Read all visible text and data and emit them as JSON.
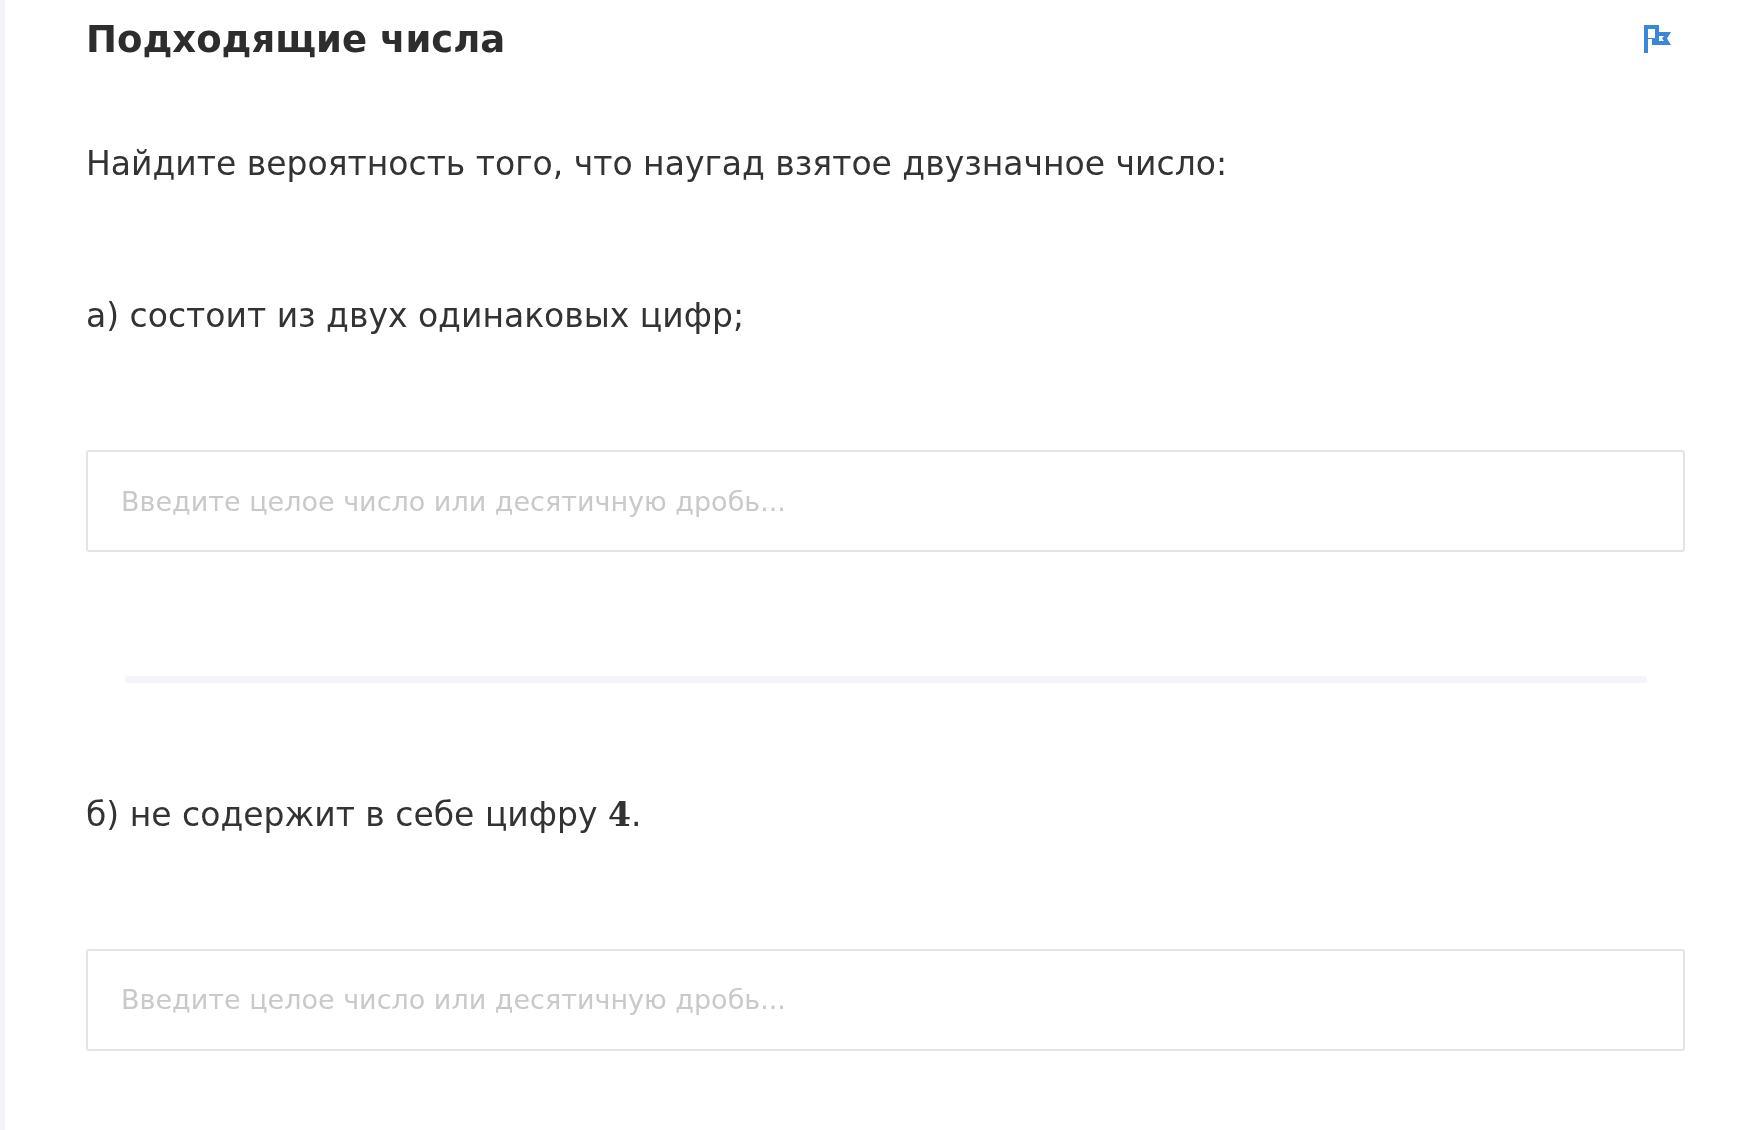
{
  "title": "Подходящие числа",
  "intro": "Найдите вероятность того, что наугад взятое двузначное число:",
  "parts": [
    {
      "before": "а) состоит из двух одинаковых цифр;",
      "placeholder": "Введите целое число или десятичную дробь..."
    },
    {
      "before": "б) не содержит в себе цифру ",
      "math": "4",
      "after": ".",
      "placeholder": "Введите целое число или десятичную дробь..."
    }
  ]
}
